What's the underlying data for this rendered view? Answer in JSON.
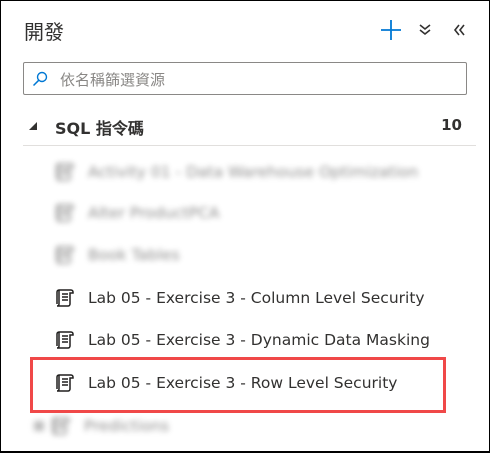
{
  "header": {
    "title": "開發",
    "add_icon": "plus-icon",
    "collapse_all_icon": "double-chevron-down-icon",
    "hide_panel_icon": "double-chevron-left-icon",
    "accent_color": "#0078d4"
  },
  "search": {
    "placeholder": "依名稱篩選資源",
    "value": "",
    "icon": "search-icon"
  },
  "section": {
    "label": "SQL 指令碼",
    "count": "10",
    "expanded": true
  },
  "items": [
    {
      "label": "Activity 01 - Data Warehouse Optimization",
      "blurred": true
    },
    {
      "label": "Alter ProductPCA",
      "blurred": true
    },
    {
      "label": "Book Tables",
      "blurred": true
    },
    {
      "label": "Lab 05 - Exercise 3 - Column Level Security",
      "blurred": false
    },
    {
      "label": "Lab 05 - Exercise 3 - Dynamic Data Masking",
      "blurred": false
    },
    {
      "label": "Lab 05 - Exercise 3 - Row Level Security",
      "blurred": false,
      "highlighted": true
    },
    {
      "label": "Predictions",
      "blurred": true
    }
  ],
  "highlight_color": "#f04848"
}
